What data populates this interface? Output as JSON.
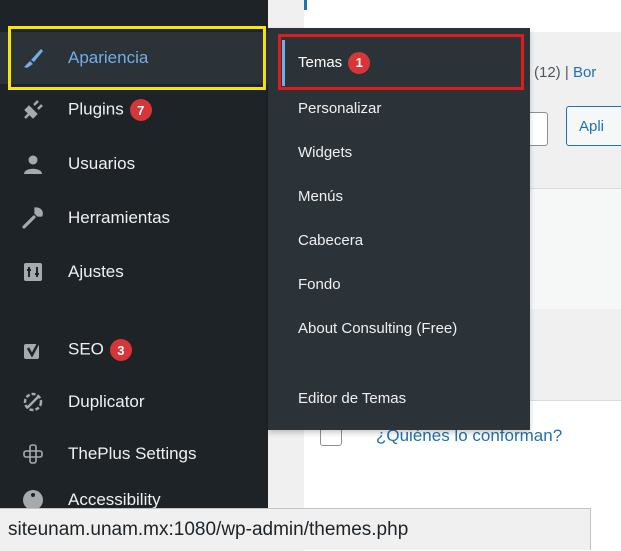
{
  "sidebar": {
    "items": [
      {
        "label": "Apariencia",
        "icon": "brush-icon"
      },
      {
        "label": "Plugins",
        "badge": "7",
        "icon": "plug-icon"
      },
      {
        "label": "Usuarios",
        "icon": "user-icon"
      },
      {
        "label": "Herramientas",
        "icon": "wrench-icon"
      },
      {
        "label": "Ajustes",
        "icon": "settings-icon"
      },
      {
        "label": "SEO",
        "badge": "3",
        "icon": "yoast-icon"
      },
      {
        "label": "Duplicator",
        "icon": "duplicator-icon"
      },
      {
        "label": "ThePlus Settings",
        "icon": "theplus-icon"
      },
      {
        "label": "Accessibility",
        "icon": "accessibility-icon"
      }
    ]
  },
  "submenu": {
    "items": [
      {
        "label": "Temas",
        "badge": "1"
      },
      {
        "label": "Personalizar"
      },
      {
        "label": "Widgets"
      },
      {
        "label": "Menús"
      },
      {
        "label": "Cabecera"
      },
      {
        "label": "Fondo"
      },
      {
        "label": "About Consulting (Free)"
      },
      {
        "label": "Editor de Temas"
      }
    ]
  },
  "content": {
    "filter_count": "(12)",
    "filter_sep": "|",
    "filter_link": "Bor",
    "apply_label": "Apli",
    "row_link": "¿Quiénes lo conforman?"
  },
  "status_url": "siteunam.unam.mx:1080/wp-admin/themes.php",
  "colors": {
    "sidebar_bg": "#1d2327",
    "submenu_bg": "#2c3338",
    "accent": "#72aee6",
    "badge": "#d63638",
    "highlight_yellow": "#f5e50a",
    "highlight_red": "#e01b1b"
  }
}
